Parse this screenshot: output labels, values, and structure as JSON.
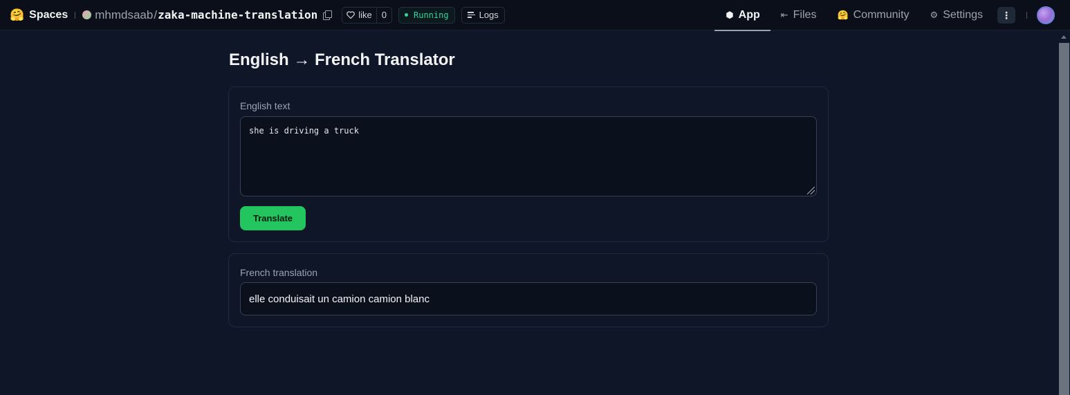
{
  "topbar": {
    "brand_emoji": "🤗",
    "brand_label": "Spaces",
    "owner": "mhmdsaab",
    "slash": "/",
    "space_name": "zaka-machine-translation",
    "like_label": "like",
    "like_count": "0",
    "status": "Running",
    "logs_label": "Logs"
  },
  "nav": {
    "tabs": [
      {
        "label": "App",
        "icon": "cube-icon",
        "glyph": "⬢",
        "active": true
      },
      {
        "label": "Files",
        "icon": "files-icon",
        "glyph": "⇤"
      },
      {
        "label": "Community",
        "icon": "community-icon",
        "glyph": "🤗"
      },
      {
        "label": "Settings",
        "icon": "gear-icon",
        "glyph": "⚙"
      }
    ],
    "kebab_glyph": "⋮"
  },
  "app": {
    "title": "English → French Translator",
    "input_label": "English text",
    "input_value": "she is driving a truck",
    "button_label": "Translate",
    "output_label": "French translation",
    "output_value": "elle conduisait un camion camion blanc"
  },
  "colors": {
    "background": "#0f1628",
    "topbar": "#0b0f19",
    "accent_button": "#22c55e",
    "status_running": "#34d399"
  }
}
